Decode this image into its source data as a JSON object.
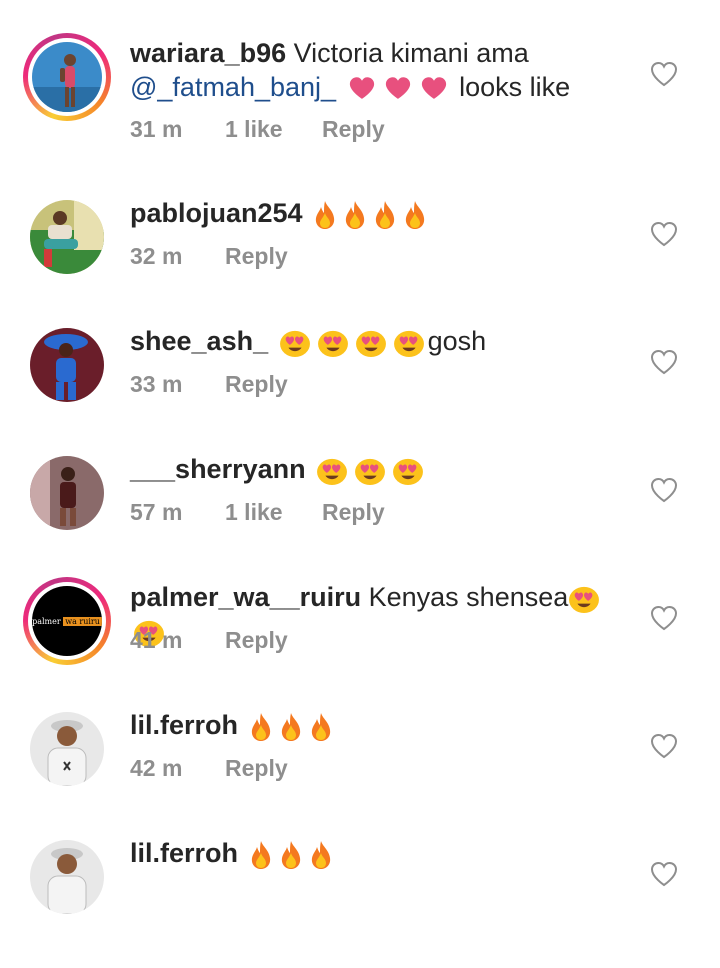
{
  "comments": [
    {
      "username": "wariara_b96",
      "text_before": "Victoria kimani ama",
      "mention": "@_fatmah_banj_",
      "emojis": [
        "pink-heart",
        "pink-heart",
        "pink-heart"
      ],
      "text_after": "looks like",
      "time": "31 m",
      "likes": "1 like",
      "reply": "Reply",
      "has_story_ring": true
    },
    {
      "username": "pablojuan254",
      "emojis": [
        "fire",
        "fire",
        "fire",
        "fire"
      ],
      "time": "32 m",
      "reply": "Reply",
      "has_story_ring": false
    },
    {
      "username": "shee_ash_",
      "emojis": [
        "heart-eyes",
        "heart-eyes",
        "heart-eyes",
        "heart-eyes"
      ],
      "text_after": "gosh",
      "time": "33 m",
      "reply": "Reply",
      "has_story_ring": false
    },
    {
      "username": "___sherryann",
      "emojis": [
        "heart-eyes",
        "heart-eyes",
        "heart-eyes"
      ],
      "time": "57 m",
      "likes": "1 like",
      "reply": "Reply",
      "has_story_ring": false
    },
    {
      "username": "palmer_wa__ruiru",
      "text_before": "Kenyas shensea",
      "emojis": [
        "heart-eyes",
        "heart-eyes"
      ],
      "time": "41 m",
      "reply": "Reply",
      "has_story_ring": true,
      "avatar_logo": {
        "left": "palmer",
        "right": "wa ruiru"
      }
    },
    {
      "username": "lil.ferroh",
      "emojis": [
        "fire",
        "fire",
        "fire"
      ],
      "time": "42 m",
      "reply": "Reply",
      "has_story_ring": false
    },
    {
      "username": "lil.ferroh",
      "emojis": [
        "fire",
        "fire",
        "fire"
      ],
      "has_story_ring": false
    }
  ],
  "colors": {
    "username": "#262626",
    "meta": "#8e8e8e",
    "mention": "#1f4e8c",
    "pink_heart": "#e8507e",
    "story_ring": "#ee2a7b"
  },
  "icons": {
    "like": "heart-outline-icon",
    "fire": "fire-emoji",
    "heart_eyes": "heart-eyes-emoji",
    "pink_heart": "pink-heart-emoji"
  }
}
